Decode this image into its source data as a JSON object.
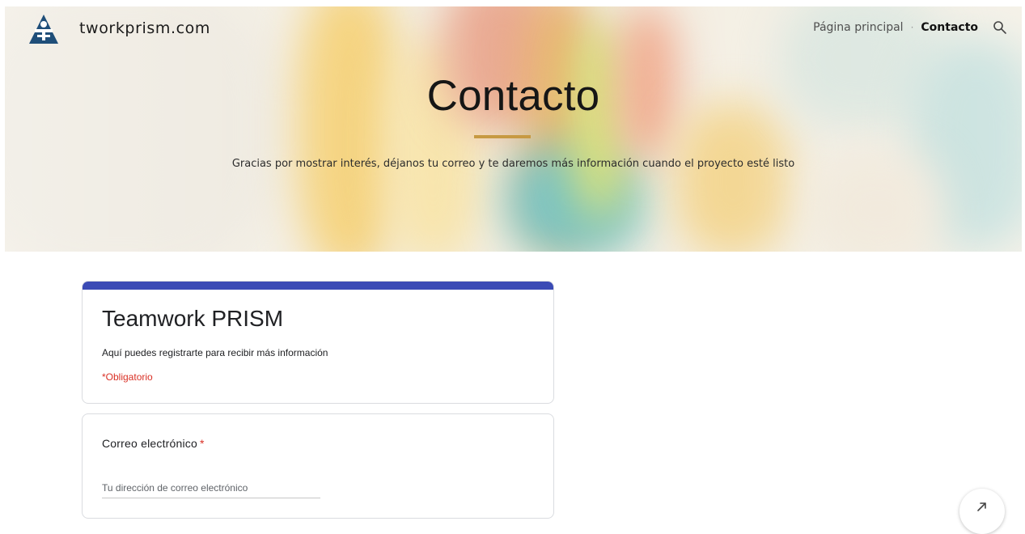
{
  "header": {
    "site_name": "tworkprism.com",
    "nav": [
      {
        "label": "Página principal",
        "active": false
      },
      {
        "label": "Contacto",
        "active": true
      }
    ],
    "search_icon": "search-icon",
    "logo_icon": "tworkprism-logo"
  },
  "hero": {
    "title": "Contacto",
    "subtitle": "Gracias por mostrar interés, déjanos tu correo y te daremos más información cuando el proyecto esté listo",
    "accent_color": "#c79a43"
  },
  "form": {
    "title": "Teamwork PRISM",
    "description": "Aquí puedes registrarte para recibir más información",
    "required_note": "*Obligatorio",
    "header_color": "#3b4bb5",
    "question": {
      "label": "Correo electrónico",
      "required_mark": "*",
      "placeholder": "Tu dirección de correo electrónico",
      "value": ""
    }
  },
  "fab_icon": "arrow-icon"
}
